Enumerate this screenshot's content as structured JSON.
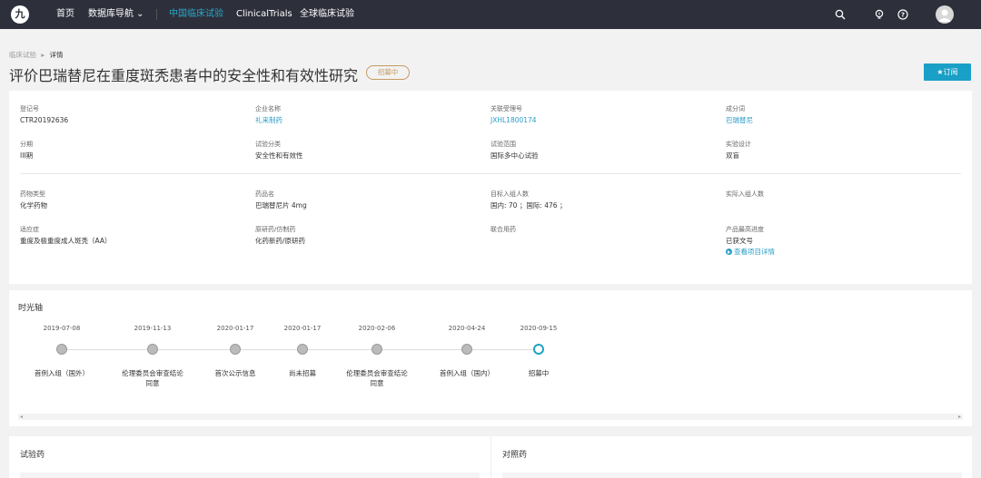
{
  "nav": {
    "logo": "九",
    "items": [
      "首页",
      "数据库导航 ⌄",
      "中国临床试验",
      "ClinicalTrials",
      "全球临床试验"
    ],
    "active_index": 2
  },
  "breadcrumb": {
    "parent": "临床试验",
    "separator": "▸",
    "current": "详情"
  },
  "title": "评价巴瑞替尼在重度斑秃患者中的安全性和有效性研究",
  "status": "招募中",
  "subscribe_label": "★订阅",
  "fields": {
    "reg_no": {
      "label": "登记号",
      "value": "CTR20192636"
    },
    "company": {
      "label": "企业名称",
      "value": "礼来制药"
    },
    "related_no": {
      "label": "关联受理号",
      "value": "JXHL1800174"
    },
    "ingredient": {
      "label": "成分词",
      "value": "巴瑞替尼"
    },
    "phase": {
      "label": "分期",
      "value": "III期"
    },
    "category": {
      "label": "试验分类",
      "value": "安全性和有效性"
    },
    "scope": {
      "label": "试验范围",
      "value": "国际多中心试验"
    },
    "design": {
      "label": "实验设计",
      "value": "双盲"
    },
    "drug_type": {
      "label": "药物类型",
      "value": "化学药物"
    },
    "drug_name": {
      "label": "药品名",
      "value": "巴瑞替尼片 4mg"
    },
    "target_enroll": {
      "label": "目标入组人数",
      "value": "国内: 70 ；国际: 476 ；"
    },
    "actual_enroll": {
      "label": "实际入组人数",
      "value": ""
    },
    "indication": {
      "label": "适应症",
      "value": "重度及极重度成人斑秃（AA）"
    },
    "origin": {
      "label": "原研药/仿制药",
      "value": "化药新药/原研药"
    },
    "combo": {
      "label": "联合用药",
      "value": ""
    },
    "progress": {
      "label": "产品最高进度",
      "value": "已获文号"
    },
    "detail_link": "查看项目详情"
  },
  "timeline": {
    "title": "时光轴",
    "events": [
      {
        "date": "2019-07-08",
        "label": "首例入组（国外）"
      },
      {
        "date": "2019-11-13",
        "label": "伦理委员会审查结论同意"
      },
      {
        "date": "2020-01-17",
        "label": "首次公示信息"
      },
      {
        "date": "2020-01-17",
        "label": "尚未招募"
      },
      {
        "date": "2020-02-06",
        "label": "伦理委员会审查结论同意"
      },
      {
        "date": "2020-04-24",
        "label": "首例入组（国内）"
      },
      {
        "date": "2020-09-15",
        "label": "招募中"
      }
    ],
    "current_index": 6
  },
  "sections": {
    "test_drug": "试验药",
    "control_drug": "对照药"
  }
}
